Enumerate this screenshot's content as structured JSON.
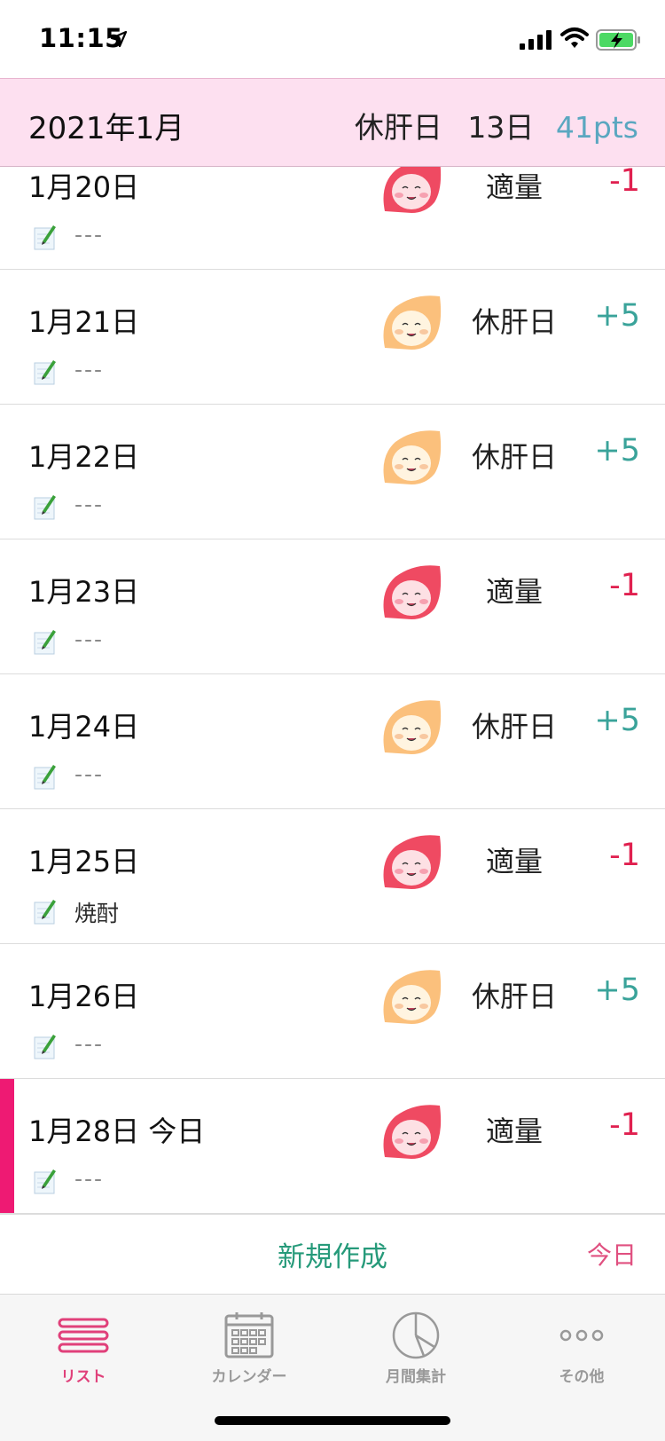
{
  "status_bar": {
    "time": "11:15"
  },
  "header": {
    "month": "2021年1月",
    "liver_rest_label": "休肝日",
    "liver_rest_days": "13日",
    "points": "41pts"
  },
  "days": [
    {
      "date": "1月20日",
      "status": "適量",
      "points": "-1",
      "note": "---",
      "mascot": "red-mascot"
    },
    {
      "date": "1月21日",
      "status": "休肝日",
      "points": "+5",
      "note": "---",
      "mascot": "orange-mascot"
    },
    {
      "date": "1月22日",
      "status": "休肝日",
      "points": "+5",
      "note": "---",
      "mascot": "orange-mascot"
    },
    {
      "date": "1月23日",
      "status": "適量",
      "points": "-1",
      "note": "---",
      "mascot": "red-mascot"
    },
    {
      "date": "1月24日",
      "status": "休肝日",
      "points": "+5",
      "note": "---",
      "mascot": "orange-mascot"
    },
    {
      "date": "1月25日",
      "status": "適量",
      "points": "-1",
      "note": "焼酎",
      "mascot": "red-mascot"
    },
    {
      "date": "1月26日",
      "status": "休肝日",
      "points": "+5",
      "note": "---",
      "mascot": "orange-mascot"
    },
    {
      "date": "1月28日 今日",
      "status": "適量",
      "points": "-1",
      "note": "---",
      "mascot": "red-mascot"
    }
  ],
  "actions": {
    "new_label": "新規作成",
    "today_label": "今日"
  },
  "tabs": [
    {
      "label": "リスト",
      "icon": "list-icon",
      "active": true
    },
    {
      "label": "カレンダー",
      "icon": "calendar-icon",
      "active": false
    },
    {
      "label": "月間集計",
      "icon": "pie-chart-icon",
      "active": false
    },
    {
      "label": "その他",
      "icon": "more-icon",
      "active": false
    }
  ],
  "colors": {
    "accent_pink": "#ee1a73",
    "header_bg": "#fde0f0",
    "positive": "#3aa39a",
    "negative": "#e0204f",
    "pts": "#5aa7c0",
    "new_button": "#269a7a"
  }
}
